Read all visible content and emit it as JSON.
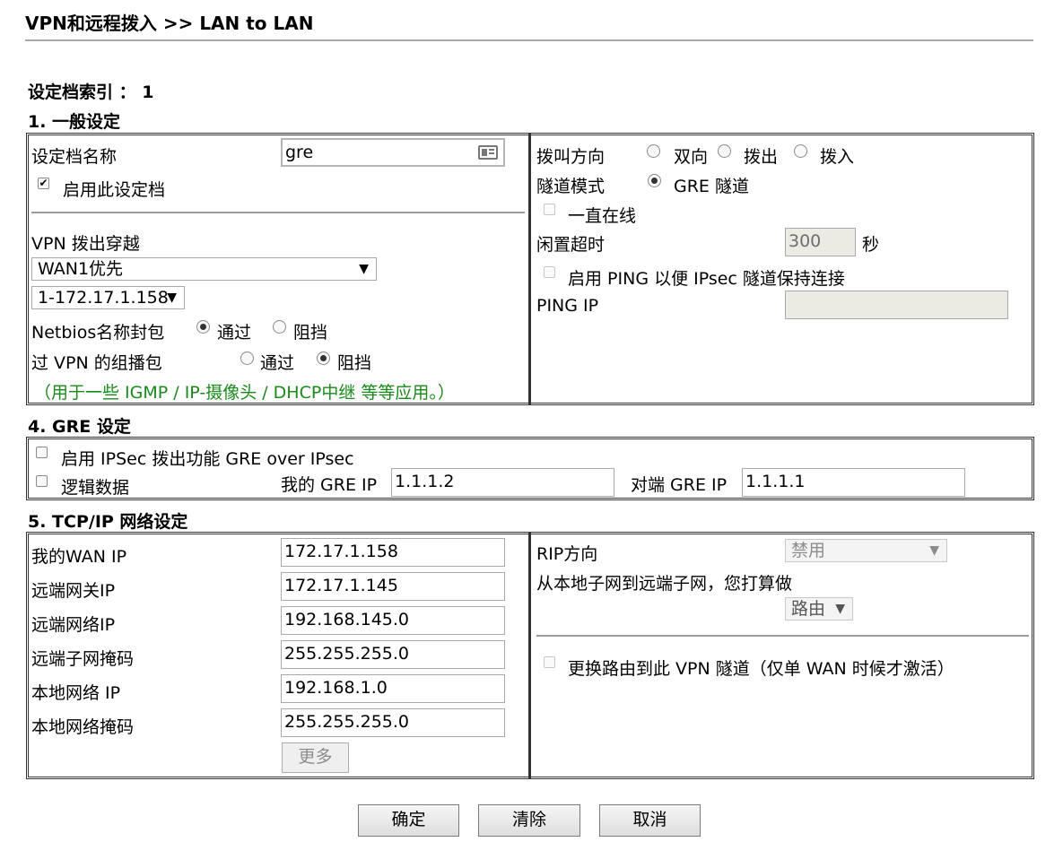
{
  "header": {
    "title": "VPN和远程拨入 >> LAN to LAN"
  },
  "profile_index": {
    "label": "设定档索引 ： 1"
  },
  "sections": {
    "general": "1. 一般设定",
    "gre": "4. GRE 设定",
    "tcpip": "5. TCP/IP 网络设定"
  },
  "general": {
    "profile_name_label": "设定档名称",
    "profile_name_value": "gre",
    "enable_label": "启用此设定档",
    "vpn_dialout_label": "VPN 拨出穿越",
    "wan_select": "WAN1优先",
    "ip_select": "1-172.17.1.158",
    "netbios_label": "Netbios名称封包",
    "pass_label": "通过",
    "block_label": "阻挡",
    "multicast_label": "过 VPN 的组播包",
    "note": "（用于一些 IGMP / IP-摄像头 / DHCP中继 等等应用。）",
    "call_direction_label": "拨叫方向",
    "dir_both": "双向",
    "dir_out": "拨出",
    "dir_in": "拨入",
    "tunnel_mode_label": "隧道模式",
    "tunnel_gre": "GRE 隧道",
    "always_on_label": "一直在线",
    "idle_timeout_label": "闲置超时",
    "idle_timeout_value": "300",
    "seconds_label": "秒",
    "ping_keepalive_label": "启用 PING 以便 IPsec 隧道保持连接",
    "ping_ip_label": "PING IP",
    "ping_ip_value": ""
  },
  "gre": {
    "ipsec_label": "启用 IPSec 拨出功能 GRE over IPsec",
    "logical_label": "逻辑数据",
    "my_gre_ip_label": "我的 GRE IP",
    "my_gre_ip_value": "1.1.1.2",
    "peer_gre_ip_label": "对端 GRE IP",
    "peer_gre_ip_value": "1.1.1.1"
  },
  "tcpip": {
    "my_wan_ip_label": "我的WAN IP",
    "my_wan_ip_value": "172.17.1.158",
    "remote_gw_label": "远端网关IP",
    "remote_gw_value": "172.17.1.145",
    "remote_net_label": "远端网络IP",
    "remote_net_value": "192.168.145.0",
    "remote_mask_label": "远端子网掩码",
    "remote_mask_value": "255.255.255.0",
    "local_net_label": "本地网络 IP",
    "local_net_value": "192.168.1.0",
    "local_mask_label": "本地网络掩码",
    "local_mask_value": "255.255.255.0",
    "more_button": "更多",
    "rip_direction_label": "RIP方向",
    "rip_direction_value": "禁用",
    "local_to_remote_label": "从本地子网到远端子网，您打算做",
    "route_mode_value": "路由",
    "change_route_label": "更换路由到此 VPN 隧道（仅单 WAN 时候才激活）"
  },
  "buttons": {
    "ok": "确定",
    "clear": "清除",
    "cancel": "取消"
  }
}
